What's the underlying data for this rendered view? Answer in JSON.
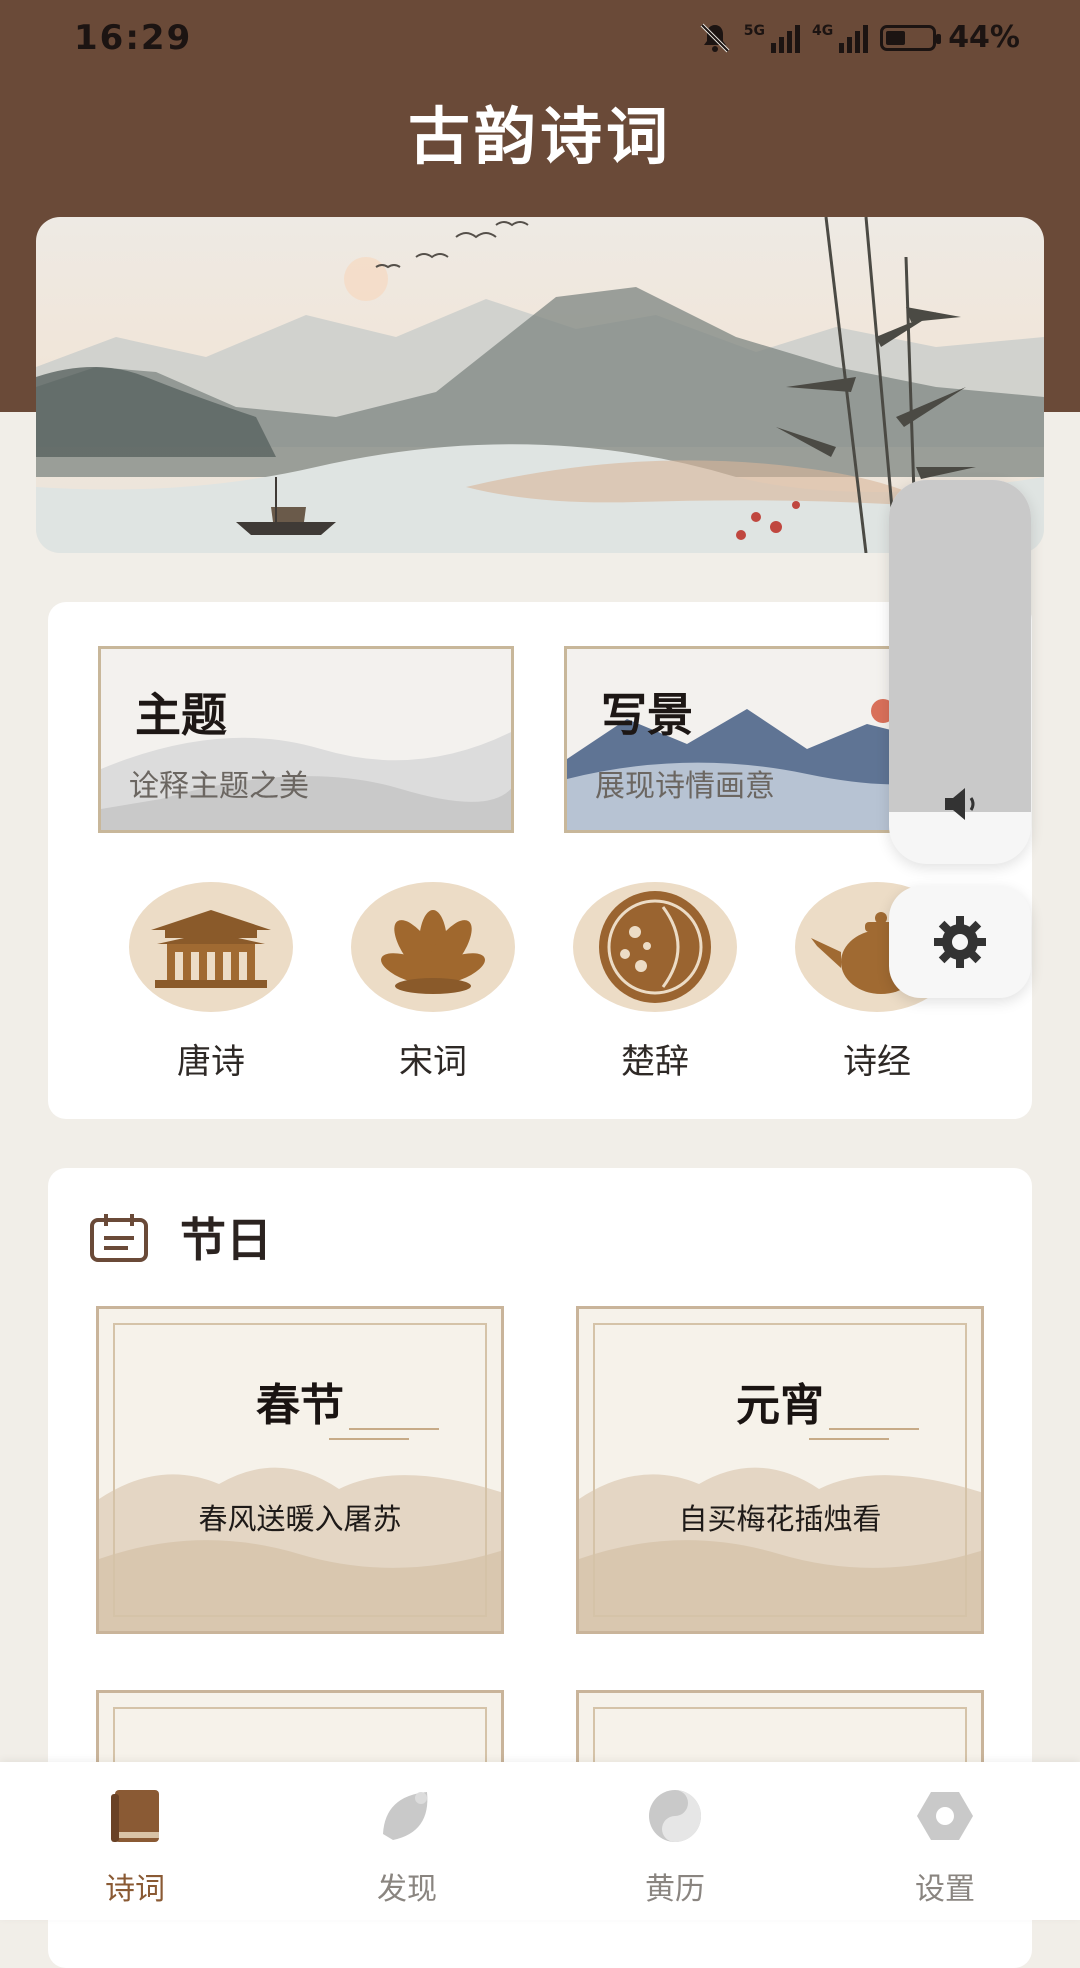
{
  "status": {
    "time": "16:29",
    "network1": "5G",
    "network2": "4G",
    "battery_text": "44%",
    "battery_level": 0.44
  },
  "app": {
    "title": "古韵诗词"
  },
  "features": [
    {
      "title": "主题",
      "subtitle": "诠释主题之美"
    },
    {
      "title": "写景",
      "subtitle": "展现诗情画意"
    }
  ],
  "categories": [
    {
      "label": "唐诗",
      "icon": "palace-icon"
    },
    {
      "label": "宋词",
      "icon": "lotus-icon"
    },
    {
      "label": "楚辞",
      "icon": "mooncake-icon"
    },
    {
      "label": "诗经",
      "icon": "teapot-icon"
    }
  ],
  "festival_section": {
    "title": "节日",
    "items": [
      {
        "title": "春节",
        "text": "春风送暖入屠苏"
      },
      {
        "title": "元宵",
        "text": "自买梅花插烛看"
      }
    ]
  },
  "tabs": [
    {
      "label": "诗词",
      "icon": "book-icon",
      "active": true
    },
    {
      "label": "发现",
      "icon": "leaf-icon",
      "active": false
    },
    {
      "label": "黄历",
      "icon": "yin-yang-icon",
      "active": false
    },
    {
      "label": "设置",
      "icon": "hexagon-settings-icon",
      "active": false
    }
  ],
  "colors": {
    "header": "#6a4a38",
    "accent": "#8a5a34",
    "background": "#f1eee8"
  }
}
